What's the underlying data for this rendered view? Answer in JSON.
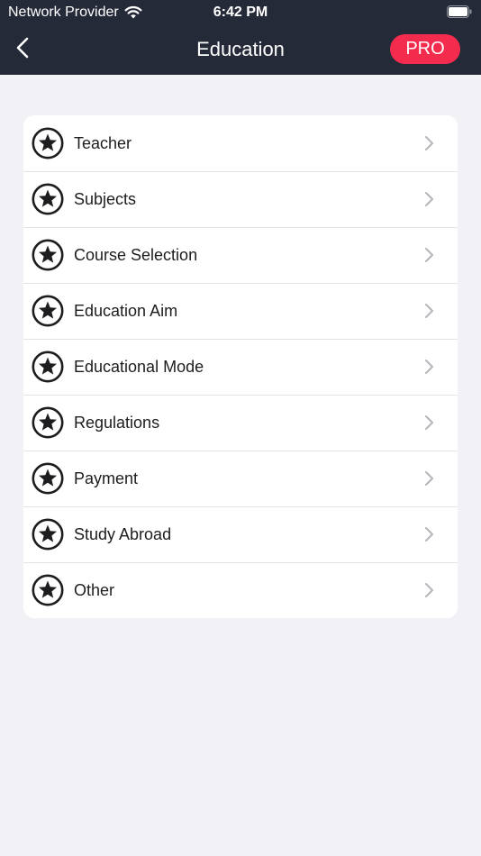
{
  "status_bar": {
    "carrier": "Network Provider",
    "time": "6:42 PM",
    "wifi_icon": "wifi-icon",
    "battery_icon": "battery-icon"
  },
  "nav": {
    "back_icon": "chevron-left-icon",
    "title": "Education",
    "pro_label": "PRO"
  },
  "colors": {
    "header_bg": "#252a38",
    "page_bg": "#f2f1f6",
    "pro_accent": "#f32c4e",
    "icon_color": "#1d1d1f",
    "chevron_color": "#b9b9bd"
  },
  "list": {
    "item_icon": "star-circle-icon",
    "chevron_icon": "chevron-right-icon",
    "items": [
      {
        "label": "Teacher"
      },
      {
        "label": "Subjects"
      },
      {
        "label": "Course Selection"
      },
      {
        "label": "Education Aim"
      },
      {
        "label": "Educational Mode"
      },
      {
        "label": "Regulations"
      },
      {
        "label": "Payment"
      },
      {
        "label": "Study Abroad"
      },
      {
        "label": "Other"
      }
    ]
  }
}
